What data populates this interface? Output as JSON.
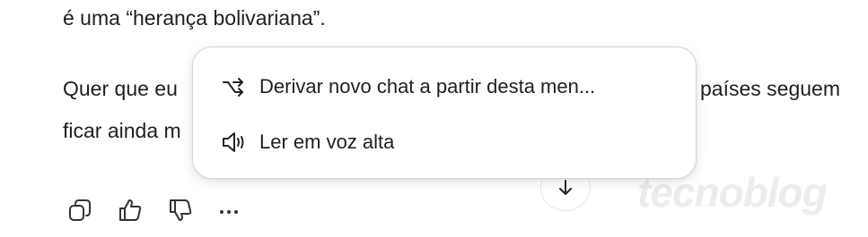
{
  "message": {
    "line1": "é uma “herança bolivariana”.",
    "line2_left": "Quer que eu",
    "line2_right": "países seguem",
    "line3_left": "ficar ainda m"
  },
  "context_menu": {
    "items": [
      {
        "label": "Derivar novo chat a partir desta men...",
        "icon": "branch-icon"
      },
      {
        "label": "Ler em voz alta",
        "icon": "speaker-icon"
      }
    ]
  },
  "scroll_button": {
    "icon": "arrow-down-icon"
  },
  "actions": [
    {
      "icon": "copy-icon"
    },
    {
      "icon": "thumbs-up-icon"
    },
    {
      "icon": "thumbs-down-icon"
    },
    {
      "icon": "more-icon"
    }
  ],
  "watermark": "tecnoblog"
}
